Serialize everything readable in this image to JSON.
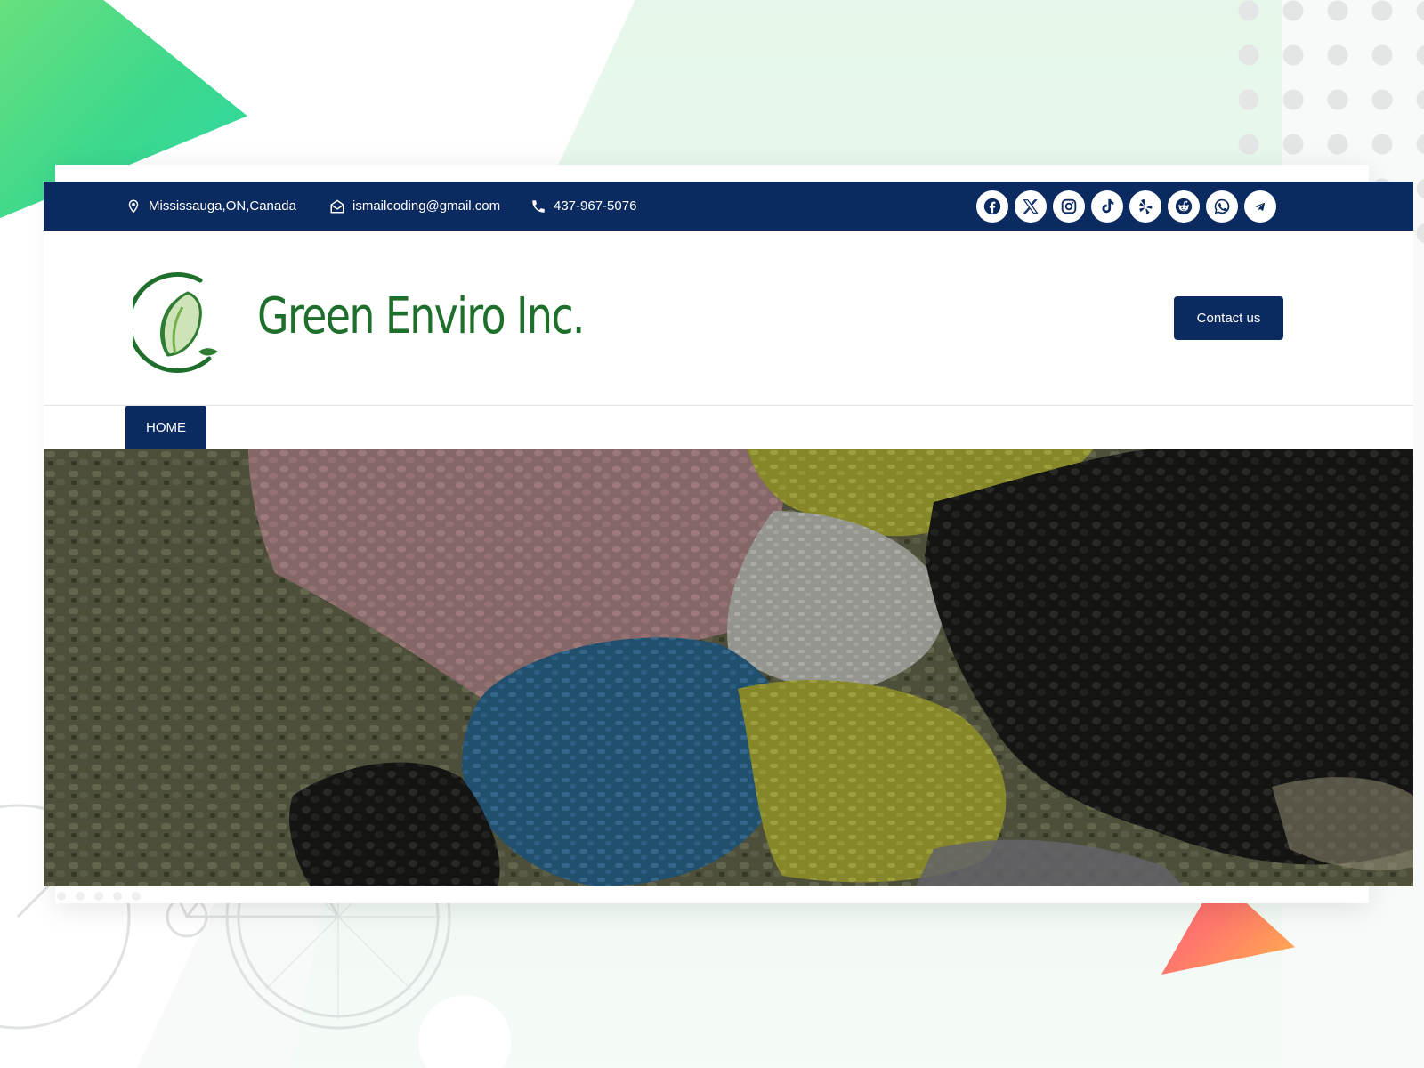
{
  "topbar": {
    "location": "Mississauga,ON,Canada",
    "email": "ismailcoding@gmail.com",
    "phone": "437-967-5076",
    "social_icons": [
      "facebook-icon",
      "x-icon",
      "instagram-icon",
      "tiktok-icon",
      "yelp-icon",
      "reddit-icon",
      "whatsapp-icon",
      "telegram-icon"
    ]
  },
  "header": {
    "logo_text": "Green Enviro Inc.",
    "contact_label": "Contact us"
  },
  "nav": {
    "home_label": "HOME"
  },
  "colors": {
    "brand_navy": "#0b2a5f",
    "logo_green": "#1e6e2c",
    "accent_green": "#3bd88e",
    "accent_orange": "#ff7a6a"
  }
}
